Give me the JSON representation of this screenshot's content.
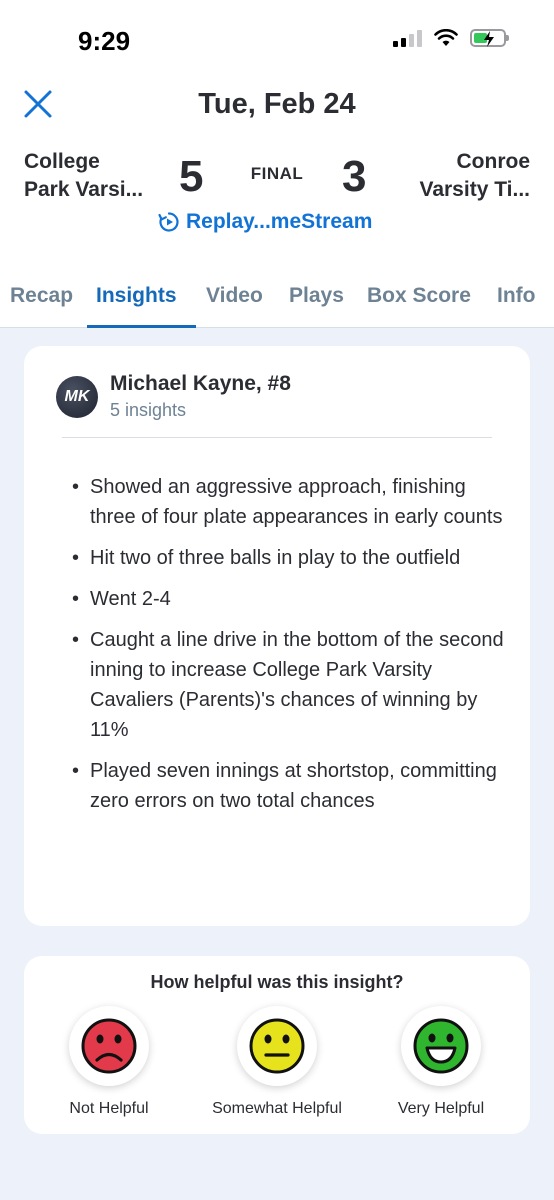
{
  "status": {
    "time": "9:29"
  },
  "header": {
    "date": "Tue, Feb 24",
    "team_left": [
      "College",
      "Park Varsi..."
    ],
    "team_right": [
      "Conroe",
      "Varsity Ti..."
    ],
    "score_left": "5",
    "score_right": "3",
    "final": "FINAL",
    "replay": "Replay...meStream"
  },
  "tabs": [
    "Recap",
    "Insights",
    "Video",
    "Plays",
    "Box Score",
    "Info"
  ],
  "insight": {
    "avatar_initials": "MK",
    "player": "Michael Kayne, #8",
    "count": "5 insights",
    "bullets": [
      "Showed an aggressive approach, finishing three of four plate appearances in early counts",
      "Hit two of three balls in play to the outfield",
      "Went 2-4",
      "Caught a line drive in the bottom of the second inning to increase College Park Varsity Cavaliers (Parents)'s chances of winning by 11%",
      "Played seven innings at shortstop, committing zero errors on two total chances"
    ]
  },
  "feedback": {
    "question": "How helpful was this insight?",
    "options": [
      {
        "label": "Not Helpful",
        "icon": "sad-face-icon",
        "color": "#e23a4a"
      },
      {
        "label": "Somewhat Helpful",
        "icon": "neutral-face-icon",
        "color": "#e6e31c"
      },
      {
        "label": "Very Helpful",
        "icon": "happy-face-icon",
        "color": "#2fb52e"
      }
    ]
  },
  "colors": {
    "accent": "#1273d6",
    "background": "#edf1f9"
  }
}
